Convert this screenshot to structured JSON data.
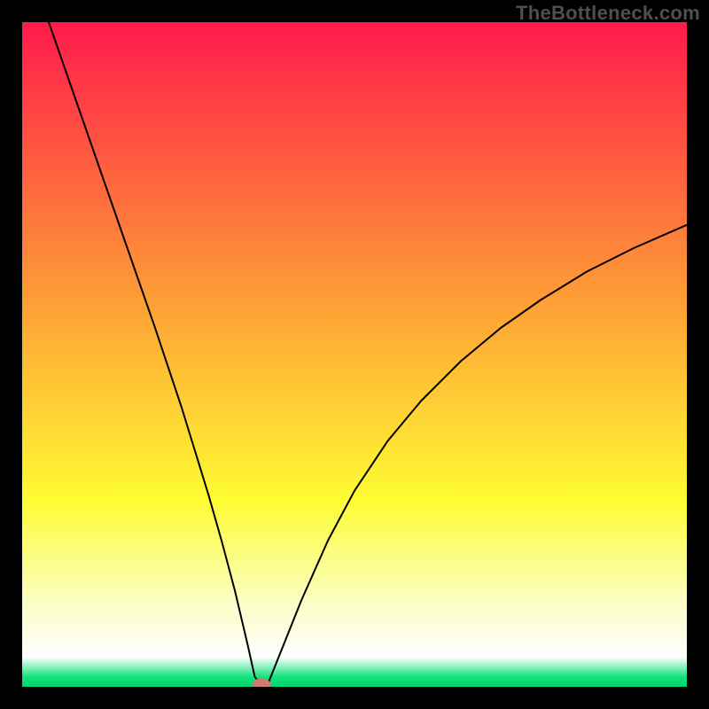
{
  "watermark": "TheBottleneck.com",
  "chart_data": {
    "type": "line",
    "title": "",
    "xlabel": "",
    "ylabel": "",
    "xlim": [
      0,
      100
    ],
    "ylim": [
      0,
      100
    ],
    "axis_visible": false,
    "background_gradient": [
      {
        "offset": 0.0,
        "color": "#ff1a4b"
      },
      {
        "offset": 0.45,
        "color": "#fea834"
      },
      {
        "offset": 0.72,
        "color": "#fefc33"
      },
      {
        "offset": 0.87,
        "color": "#fbfec2"
      },
      {
        "offset": 0.955,
        "color": "#ffffff"
      },
      {
        "offset": 0.985,
        "color": "#13e27d"
      },
      {
        "offset": 1.0,
        "color": "#00d36b"
      }
    ],
    "series": [
      {
        "name": "bottleneck-curve",
        "stroke": "#000000",
        "stroke_width": 2,
        "x": [
          4,
          8,
          12,
          16,
          20,
          24,
          28,
          30,
          32,
          34,
          35,
          36,
          37,
          38,
          42,
          46,
          50,
          55,
          60,
          66,
          72,
          78,
          85,
          92,
          100
        ],
        "y": [
          100,
          88.5,
          77,
          65.5,
          54,
          42,
          29,
          22,
          14.5,
          6,
          1.5,
          0.3,
          0.5,
          3,
          13,
          22,
          29.5,
          37,
          43,
          49,
          54,
          58.2,
          62.5,
          66,
          69.5
        ]
      }
    ],
    "marker": {
      "name": "optimal-point",
      "x": 36,
      "y": 0.3,
      "rx": 1.4,
      "ry": 1.0,
      "color": "#d17a72"
    }
  }
}
